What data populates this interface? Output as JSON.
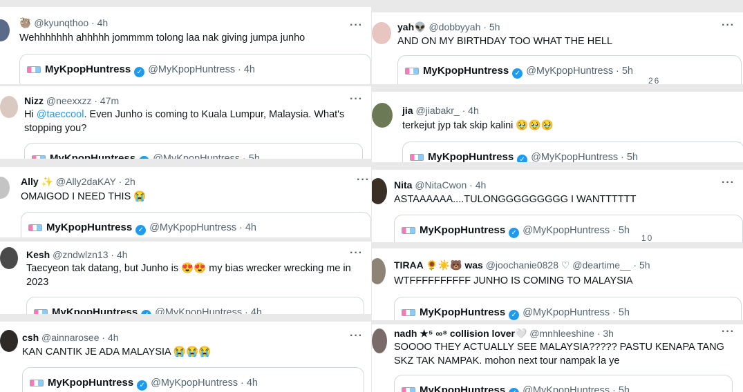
{
  "quote": {
    "name": "MyKpopHuntress",
    "handle": "@MyKpopHuntress"
  },
  "left": [
    {
      "name": "🦥",
      "handle": "@kyunqthoo",
      "time": "· 4h",
      "text": "Wehhhhhhh ahhhhh jommmm tolong laa nak giving jumpa junho",
      "qtime": "· 4h"
    },
    {
      "name": "Nizz",
      "handle": "@neexxzz",
      "time": "· 47m",
      "text_pre": "Hi ",
      "mention": "@taeccool",
      "text_post": ". Even Junho is coming to Kuala Lumpur, Malaysia. What's stopping you?",
      "qtime": "· 5h"
    },
    {
      "name": "Ally ✨",
      "handle": "@Ally2daKAY",
      "time": "· 2h",
      "text": "OMAIGOD I NEED THIS 😭",
      "qtime": "· 4h"
    },
    {
      "name": "Kesh",
      "handle": "@zndwlzn13",
      "time": "· 4h",
      "text": "Taecyeon tak datang, but Junho is 😍😍 my bias wrecker wrecking me in 2023",
      "qtime": "· 4h"
    },
    {
      "name": "csh",
      "handle": "@ainnarosee",
      "time": "· 4h",
      "text": "KAN CANTIK JE ADA MALAYSIA 😭😭😭",
      "qtime": "· 4h"
    }
  ],
  "right": [
    {
      "name": "yah👽",
      "handle": "@dobbyyah",
      "time": "· 5h",
      "text": "AND ON MY BIRTHDAY TOO WHAT THE HELL",
      "qtime": "· 5h",
      "frag": "26"
    },
    {
      "name": "jia",
      "handle": "@jiabakr_",
      "time": "· 4h",
      "text": "terkejut jyp tak skip kalini 🥹🥹🥹",
      "qtime": "· 5h"
    },
    {
      "name": "Nita",
      "handle": "@NitaCwon",
      "time": "· 4h",
      "text": "ASTAAAAAA....TULONGGGGGGGGG I WANTTTTTT",
      "qtime": "· 5h",
      "frag": "10"
    },
    {
      "name": "TIRAA 🌻☀️🐻 was",
      "handle": "@joochanie0828 ♡ @deartime__",
      "time": "· 5h",
      "text": "WTFFFFFFFFFF JUNHO IS COMING TO MALAYSIA",
      "qtime": "· 5h"
    },
    {
      "name": "nadh ★⁵ ∞⁸ collision lover🤍",
      "handle": "@mnhleeshine",
      "time": "· 3h",
      "text": "SOOOO THEY ACTUALLY SEE MALAYSIA????? PASTU KENAPA TANG SKZ TAK NAMPAK. mohon next tour nampak la ye",
      "qtime": "· 5h"
    }
  ]
}
